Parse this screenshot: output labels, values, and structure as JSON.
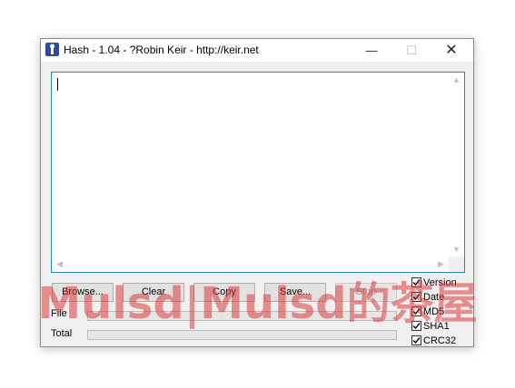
{
  "window": {
    "title": "Hash - 1.04 - ?Robin Keir - http://keir.net",
    "minimize_glyph": "—",
    "maximize_glyph": "☐",
    "close_glyph": "✕"
  },
  "output": {
    "value": ""
  },
  "buttons": {
    "browse": "Browse...",
    "clear": "Clear",
    "copy": "Copy",
    "save": "Save...",
    "stop": "Stop"
  },
  "progress": {
    "file_label": "File",
    "file_value": 0,
    "total_label": "Total",
    "total_value": 0
  },
  "options": [
    {
      "label": "Version",
      "checked": true
    },
    {
      "label": "Date",
      "checked": true
    },
    {
      "label": "MD5",
      "checked": true
    },
    {
      "label": "SHA1",
      "checked": true
    },
    {
      "label": "CRC32",
      "checked": true
    }
  ],
  "watermark": "Mulsd|Mulsd的茶屋",
  "colors": {
    "accent": "#1e8ab0",
    "watermark": "#dc3c3c"
  }
}
